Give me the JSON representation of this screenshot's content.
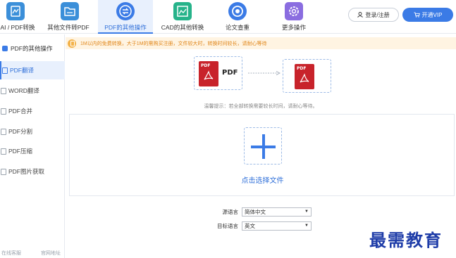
{
  "toolbar": {
    "items": [
      {
        "label": "AI / PDF转换",
        "icon": "ai-pdf-icon",
        "color": "#3b8fd9"
      },
      {
        "label": "其他文件转PDF",
        "icon": "folder-icon",
        "color": "#3b8fd9"
      },
      {
        "label": "PDF的其他操作",
        "icon": "transfer-icon",
        "color": "#3b7be6",
        "active": true
      },
      {
        "label": "CAD的其他转换",
        "icon": "image-icon",
        "color": "#26b38a"
      },
      {
        "label": "论文查重",
        "icon": "check-icon",
        "color": "#3b7be6"
      },
      {
        "label": "更多操作",
        "icon": "gear-icon",
        "color": "#8a6de0"
      }
    ],
    "login_label": "登录/注册",
    "vip_label": "开通VIP"
  },
  "sidebar": {
    "header": "PDF的其他操作",
    "items": [
      {
        "label": "PDF翻译",
        "active": true
      },
      {
        "label": "WORD翻译"
      },
      {
        "label": "PDF合并"
      },
      {
        "label": "PDF分割"
      },
      {
        "label": "PDF压缩"
      },
      {
        "label": "PDF图片获取"
      }
    ],
    "footer_left": "在线客服",
    "footer_right": "官网地址"
  },
  "notice": "1M以内的免费转换，大于1M的需购买注册，文件较大时，转换时间较长，请耐心等待",
  "diagram": {
    "source_badge": "PDF",
    "source_label": "PDF",
    "target_badge": "PDF"
  },
  "tip": "温馨提示：若全部转换需要较长时间，请耐心等待。",
  "upload": {
    "label": "点击选择文件"
  },
  "language": {
    "source_label": "源语言",
    "source_value": "简体中文",
    "target_label": "目标语言",
    "target_value": "英文"
  },
  "watermark": "最需教育",
  "colors": {
    "accent": "#3b7be6",
    "pdf_red": "#c8232b",
    "notice_text": "#e0861a"
  }
}
